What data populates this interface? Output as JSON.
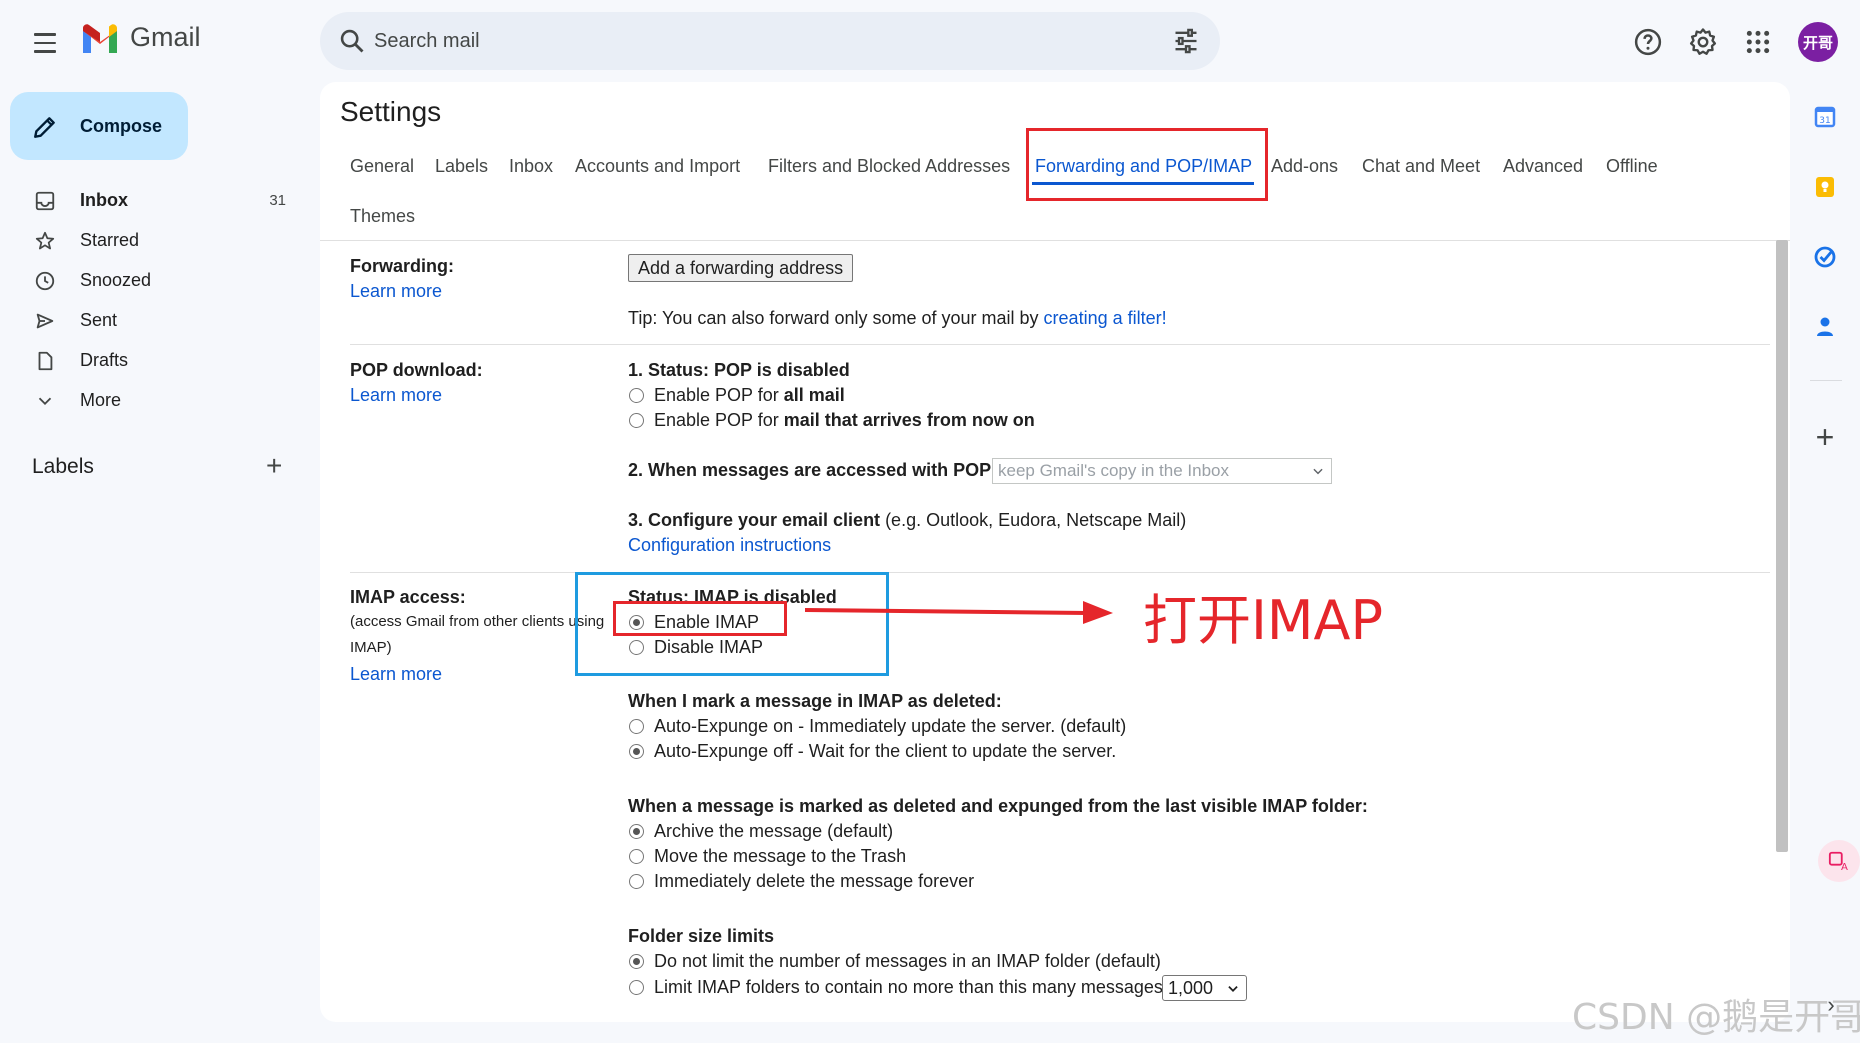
{
  "header": {
    "app_name": "Gmail",
    "search_placeholder": "Search mail",
    "avatar_text": "开哥"
  },
  "sidebar": {
    "compose_label": "Compose",
    "items": [
      {
        "label": "Inbox",
        "count": "31",
        "icon": "inbox-icon"
      },
      {
        "label": "Starred",
        "count": "",
        "icon": "star-icon"
      },
      {
        "label": "Snoozed",
        "count": "",
        "icon": "clock-icon"
      },
      {
        "label": "Sent",
        "count": "",
        "icon": "send-icon"
      },
      {
        "label": "Drafts",
        "count": "",
        "icon": "draft-icon"
      },
      {
        "label": "More",
        "count": "",
        "icon": "chevron-down-icon"
      }
    ],
    "labels_heading": "Labels"
  },
  "settings": {
    "title": "Settings",
    "tabs": [
      "General",
      "Labels",
      "Inbox",
      "Accounts and Import",
      "Filters and Blocked Addresses",
      "Forwarding and POP/IMAP",
      "Add-ons",
      "Chat and Meet",
      "Advanced",
      "Offline",
      "Themes"
    ],
    "active_tab": "Forwarding and POP/IMAP",
    "forwarding": {
      "label": "Forwarding:",
      "learn_more": "Learn more",
      "button": "Add a forwarding address",
      "tip_prefix": "Tip: You can also forward only some of your mail by ",
      "tip_link": "creating a filter!"
    },
    "pop": {
      "label": "POP download:",
      "learn_more": "Learn more",
      "status": "1. Status: POP is disabled",
      "opt1_prefix": "Enable POP for ",
      "opt1_bold": "all mail",
      "opt2_prefix": "Enable POP for ",
      "opt2_bold": "mail that arrives from now on",
      "accessed_label": "2. When messages are accessed with POP",
      "accessed_value": "keep Gmail's copy in the Inbox",
      "configure_bold": "3. Configure your email client",
      "configure_rest": " (e.g. Outlook, Eudora, Netscape Mail)",
      "config_link": "Configuration instructions"
    },
    "imap": {
      "label": "IMAP access:",
      "sub": "(access Gmail from other clients using IMAP)",
      "learn_more": "Learn more",
      "status": "Status: IMAP is disabled",
      "enable": "Enable IMAP",
      "disable": "Disable IMAP",
      "deleted_heading": "When I mark a message in IMAP as deleted:",
      "deleted_opt1": "Auto-Expunge on - Immediately update the server. (default)",
      "deleted_opt2": "Auto-Expunge off - Wait for the client to update the server.",
      "expunged_heading": "When a message is marked as deleted and expunged from the last visible IMAP folder:",
      "expunged_opt1": "Archive the message (default)",
      "expunged_opt2": "Move the message to the Trash",
      "expunged_opt3": "Immediately delete the message forever",
      "folder_heading": "Folder size limits",
      "folder_opt1": "Do not limit the number of messages in an IMAP folder (default)",
      "folder_opt2": "Limit IMAP folders to contain no more than this many messages",
      "folder_limit_value": "1,000"
    }
  },
  "annotation": {
    "text": "打开IMAP",
    "watermark": "CSDN @鹅是开哥"
  },
  "colors": {
    "accent": "#0b57d0",
    "annotation_red": "#e5262b",
    "annotation_blue": "#1e9be0",
    "compose_bg": "#c2e7ff"
  }
}
